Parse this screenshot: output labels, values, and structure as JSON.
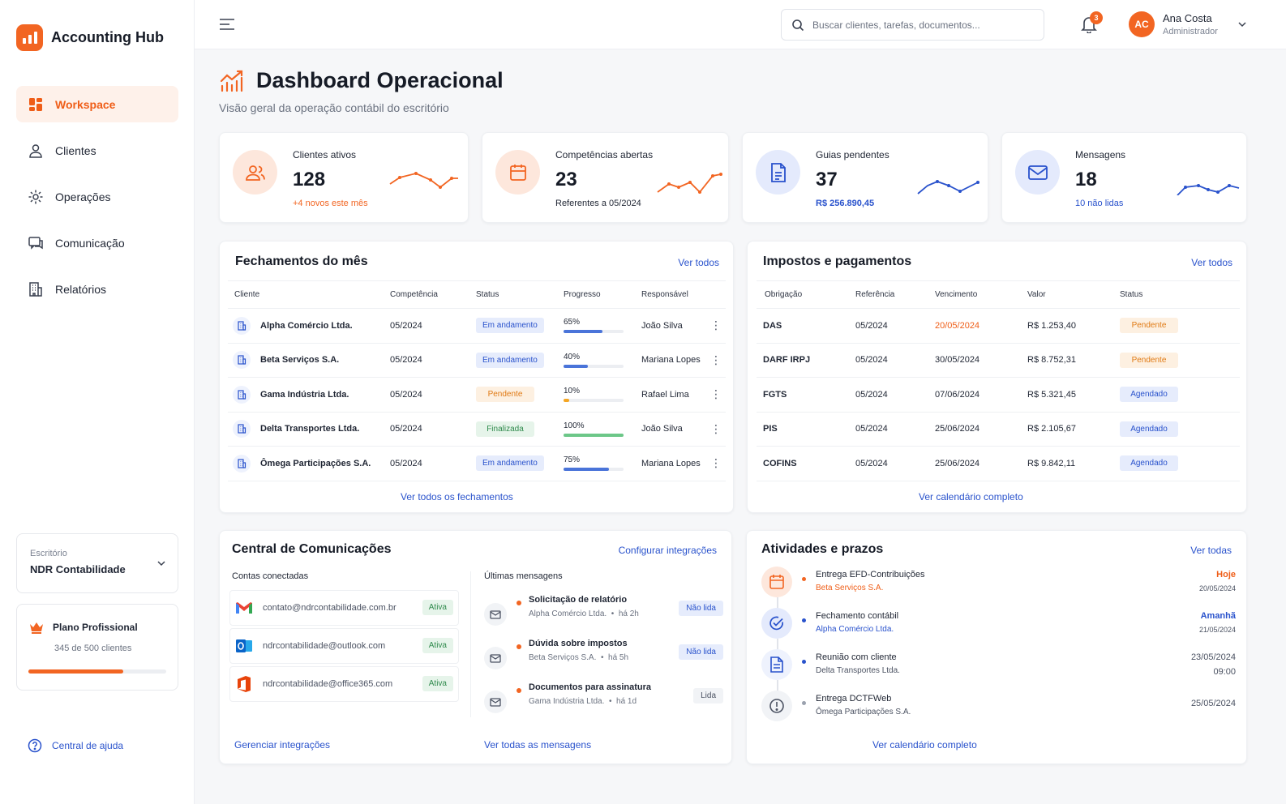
{
  "brand": {
    "name": "Accounting Hub"
  },
  "nav": [
    {
      "label": "Workspace",
      "icon": "grid-icon",
      "active": true
    },
    {
      "label": "Clientes",
      "icon": "user-icon"
    },
    {
      "label": "Operações",
      "icon": "gear-icon"
    },
    {
      "label": "Comunicação",
      "icon": "chat-icon"
    },
    {
      "label": "Relatórios",
      "icon": "building-icon"
    }
  ],
  "office": {
    "label": "Escritório",
    "name": "NDR Contabilidade"
  },
  "plan": {
    "title": "Plano Profissional",
    "usage": "345 de 500 clientes",
    "progress": 0.69
  },
  "help": {
    "label": "Central de ajuda"
  },
  "topbar": {
    "search_placeholder": "Buscar clientes, tarefas, documentos...",
    "notifications": "3",
    "user": {
      "initials": "AC",
      "name": "Ana Costa",
      "role": "Administrador"
    }
  },
  "page": {
    "title": "Dashboard Operacional",
    "subtitle": "Visão geral da operação contábil do escritório"
  },
  "kpis": [
    {
      "label": "Clientes ativos",
      "value": "128",
      "sub": "+4 novos este mês",
      "accent": "#f26522"
    },
    {
      "label": "Competências abertas",
      "value": "23",
      "sub": "Referentes a 05/2024",
      "accent": "#f26522"
    },
    {
      "label": "Guias pendentes",
      "value": "37",
      "sub": "R$ 256.890,45",
      "accent": "#2952cc"
    },
    {
      "label": "Mensagens",
      "value": "18",
      "sub": "10 não lidas",
      "accent": "#2952cc"
    }
  ],
  "closings": {
    "title": "Fechamentos do mês",
    "link": "Ver todos",
    "headers": [
      "Cliente",
      "Competência",
      "Status",
      "Progresso",
      "Responsável"
    ],
    "rows": [
      {
        "client": "Alpha Comércio Ltda.",
        "period": "05/2024",
        "status": "Em andamento",
        "status_kind": "blue",
        "progress": 65,
        "progress_label": "65%",
        "owner": "João Silva"
      },
      {
        "client": "Beta Serviços S.A.",
        "period": "05/2024",
        "status": "Em andamento",
        "status_kind": "blue",
        "progress": 40,
        "progress_label": "40%",
        "owner": "Mariana Lopes"
      },
      {
        "client": "Gama Indústria Ltda.",
        "period": "05/2024",
        "status": "Pendente",
        "status_kind": "orange",
        "progress": 10,
        "progress_label": "10%",
        "owner": "Rafael Lima"
      },
      {
        "client": "Delta Transportes Ltda.",
        "period": "05/2024",
        "status": "Finalizada",
        "status_kind": "green",
        "progress": 100,
        "progress_label": "100%",
        "owner": "João Silva"
      },
      {
        "client": "Ômega Participações S.A.",
        "period": "05/2024",
        "status": "Em andamento",
        "status_kind": "blue",
        "progress": 75,
        "progress_label": "75%",
        "owner": "Mariana Lopes"
      }
    ],
    "footer": "Ver todos os fechamentos"
  },
  "taxes": {
    "title": "Impostos e pagamentos",
    "link": "Ver todos",
    "headers": [
      "Obrigação",
      "Referência",
      "Vencimento",
      "Valor",
      "Status"
    ],
    "rows": [
      {
        "name": "DAS",
        "ref": "05/2024",
        "due": "20/05/2024",
        "overdue": true,
        "value": "R$ 1.253,40",
        "status": "Pendente",
        "status_kind": "orange"
      },
      {
        "name": "DARF IRPJ",
        "ref": "05/2024",
        "due": "30/05/2024",
        "overdue": false,
        "value": "R$ 8.752,31",
        "status": "Pendente",
        "status_kind": "orange"
      },
      {
        "name": "FGTS",
        "ref": "05/2024",
        "due": "07/06/2024",
        "overdue": false,
        "value": "R$ 5.321,45",
        "status": "Agendado",
        "status_kind": "blue"
      },
      {
        "name": "PIS",
        "ref": "05/2024",
        "due": "25/06/2024",
        "overdue": false,
        "value": "R$ 2.105,67",
        "status": "Agendado",
        "status_kind": "blue"
      },
      {
        "name": "COFINS",
        "ref": "05/2024",
        "due": "25/06/2024",
        "overdue": false,
        "value": "R$ 9.842,11",
        "status": "Agendado",
        "status_kind": "blue"
      }
    ],
    "footer": "Ver calendário completo"
  },
  "comms": {
    "title": "Central de Comunicações",
    "link": "Configurar integrações",
    "accounts_label": "Contas conectadas",
    "accounts": [
      {
        "email": "contato@ndrcontabilidade.com.br",
        "provider": "gmail-icon",
        "status": "Ativa"
      },
      {
        "email": "ndrcontabilidade@outlook.com",
        "provider": "outlook-icon",
        "status": "Ativa"
      },
      {
        "email": "ndrcontabilidade@office365.com",
        "provider": "office-icon",
        "status": "Ativa"
      }
    ],
    "messages_label": "Últimas mensagens",
    "messages": [
      {
        "title": "Solicitação de relatório",
        "from": "Alpha Comércio Ltda.",
        "time": "há 2h",
        "badge": "Não lida",
        "unread": true
      },
      {
        "title": "Dúvida sobre impostos",
        "from": "Beta Serviços S.A.",
        "time": "há 5h",
        "badge": "Não lida",
        "unread": true
      },
      {
        "title": "Documentos para assinatura",
        "from": "Gama Indústria Ltda.",
        "time": "há 1d",
        "badge": "Lida",
        "unread": false
      }
    ],
    "sep": "•",
    "footer_left": "Gerenciar integrações",
    "footer_right": "Ver todas as mensagens"
  },
  "activities": {
    "title": "Atividades e prazos",
    "link": "Ver todas",
    "items": [
      {
        "title": "Entrega EFD-Contribuições",
        "sub": "Beta Serviços S.A.",
        "when": "Hoje",
        "date": "20/05/2024",
        "icon": "calendar-icon",
        "kind": "orange"
      },
      {
        "title": "Fechamento contábil",
        "sub": "Alpha Comércio Ltda.",
        "when": "Amanhã",
        "date": "21/05/2024",
        "icon": "check-circle-icon",
        "kind": "blue"
      },
      {
        "title": "Reunião com cliente",
        "sub": "Delta Transportes Ltda.",
        "when": "23/05/2024",
        "date": "09:00",
        "icon": "document-icon",
        "kind": "blue-plain"
      },
      {
        "title": "Entrega DCTFWeb",
        "sub": "Ômega Participações S.A.",
        "when": "25/05/2024",
        "date": "",
        "icon": "info-icon",
        "kind": "gray"
      }
    ],
    "footer": "Ver calendário completo"
  }
}
